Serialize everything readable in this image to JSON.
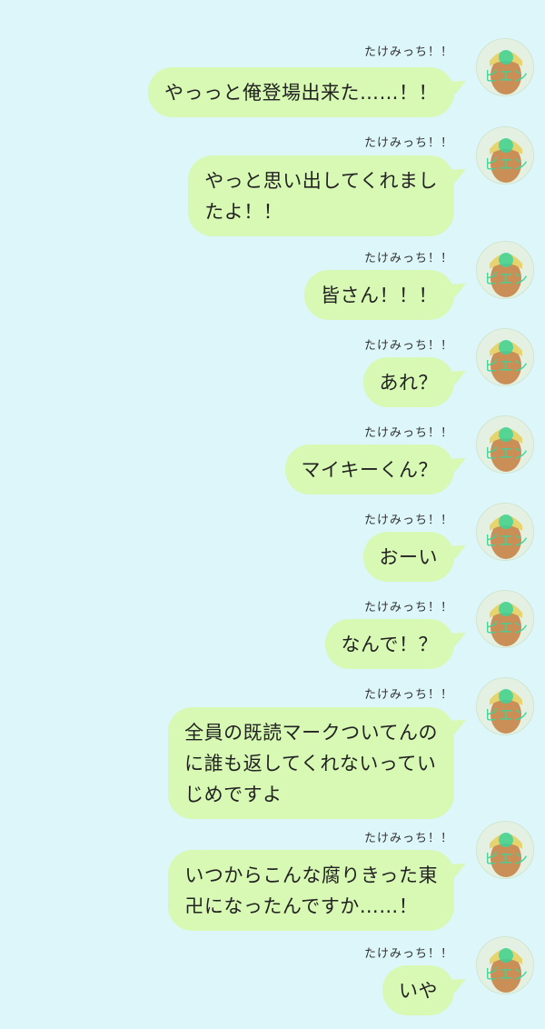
{
  "conversation": {
    "messages": [
      {
        "sender": "たけみっち！！",
        "text": "やっっと俺登場出来た……！！"
      },
      {
        "sender": "たけみっち！！",
        "text": "やっと思い出してくれまし\nたよ！！"
      },
      {
        "sender": "たけみっち！！",
        "text": "皆さん！！！"
      },
      {
        "sender": "たけみっち！！",
        "text": "あれ？"
      },
      {
        "sender": "たけみっち！！",
        "text": "マイキーくん？"
      },
      {
        "sender": "たけみっち！！",
        "text": "おーい"
      },
      {
        "sender": "たけみっち！！",
        "text": "なんで！？"
      },
      {
        "sender": "たけみっち！！",
        "text": "全員の既読マークついてんの\nに誰も返してくれないってい\nじめですよ"
      },
      {
        "sender": "たけみっち！！",
        "text": "いつからこんな腐りきった東\n卍になったんですか……！"
      },
      {
        "sender": "たけみっち！！",
        "text": "いや"
      }
    ]
  },
  "colors": {
    "background": "#dcf6fa",
    "bubble": "#d7f9b4",
    "text": "#222222"
  },
  "icons": {
    "avatar": "user-avatar-icon"
  }
}
